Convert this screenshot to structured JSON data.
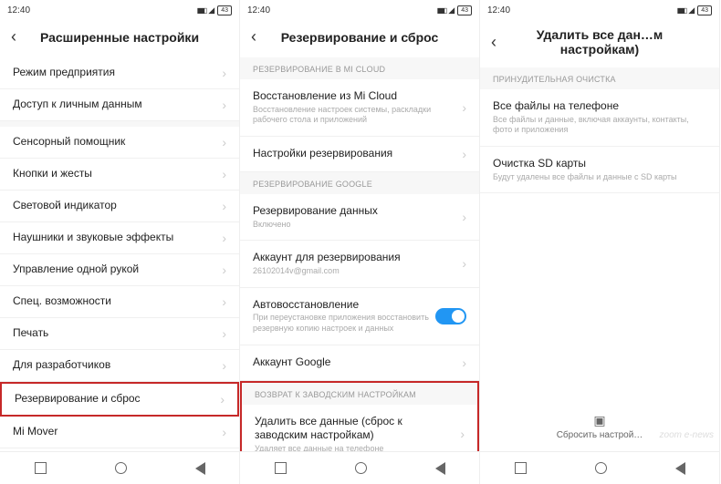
{
  "status": {
    "time": "12:40",
    "battery": "43"
  },
  "screen1": {
    "title": "Расширенные настройки",
    "items": [
      "Режим предприятия",
      "Доступ к личным данным",
      "Сенсорный помощник",
      "Кнопки и жесты",
      "Световой индикатор",
      "Наушники и звуковые эффекты",
      "Управление одной рукой",
      "Спец. возможности",
      "Печать",
      "Для разработчиков",
      "Резервирование и сброс",
      "Mi Mover"
    ]
  },
  "screen2": {
    "title": "Резервирование и сброс",
    "sec_micloud": "РЕЗЕРВИРОВАНИЕ В MI CLOUD",
    "restore_micloud": "Восстановление из Mi Cloud",
    "restore_micloud_sub": "Восстановление настроек системы, раскладки рабочего стола и приложений",
    "backup_settings": "Настройки резервирования",
    "sec_google": "РЕЗЕРВИРОВАНИЕ GOOGLE",
    "backup_data": "Резервирование данных",
    "backup_data_sub": "Включено",
    "backup_account": "Аккаунт для резервирования",
    "backup_account_sub": "26102014v@gmail.com",
    "auto_restore": "Автовосстановление",
    "auto_restore_sub": "При переустановке приложения восстановить резервную копию настроек и данных",
    "google_account": "Аккаунт Google",
    "sec_factory": "ВОЗВРАТ К ЗАВОДСКИМ НАСТРОЙКАМ",
    "erase_all": "Удалить все данные (сброс к заводским настройкам)",
    "erase_all_sub": "Удаляет все данные на телефоне"
  },
  "screen3": {
    "title": "Удалить все дан…м настройкам)",
    "sec_force": "ПРИНУДИТЕЛЬНАЯ ОЧИСТКА",
    "all_files": "Все файлы на телефоне",
    "all_files_sub": "Все файлы и данные, включая аккаунты, контакты, фото и приложения",
    "sd_clean": "Очистка SD карты",
    "sd_clean_sub": "Будут удалены все файлы и данные с SD карты",
    "reset_label": "Сбросить настрой…"
  },
  "watermark": "zoom e-news"
}
